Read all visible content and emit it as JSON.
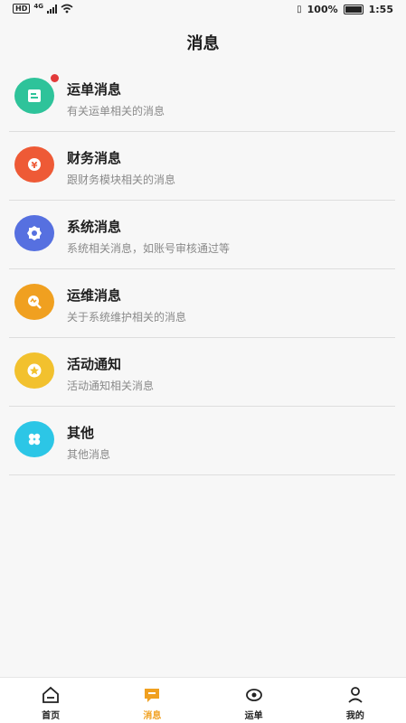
{
  "status_bar": {
    "network": "HD",
    "signal_label": "4G",
    "battery": "100%",
    "time": "1:55"
  },
  "page": {
    "title": "消息"
  },
  "messages": [
    {
      "name": "运单消息",
      "desc": "有关运单相关的消息",
      "icon": "document-icon",
      "color": "#2ec39a",
      "unread": true
    },
    {
      "name": "财务消息",
      "desc": "跟财务模块相关的消息",
      "icon": "yen-icon",
      "color": "#ee5a36",
      "unread": false
    },
    {
      "name": "系统消息",
      "desc": "系统相关消息，如账号审核通过等",
      "icon": "gear-icon",
      "color": "#5670e0",
      "unread": false
    },
    {
      "name": "运维消息",
      "desc": "关于系统维护相关的消息",
      "icon": "maintenance-icon",
      "color": "#f0a020",
      "unread": false
    },
    {
      "name": "活动通知",
      "desc": "活动通知相关消息",
      "icon": "star-icon",
      "color": "#f2c12e",
      "unread": false
    },
    {
      "name": "其他",
      "desc": "其他消息",
      "icon": "grid-icon",
      "color": "#2cc6e6",
      "unread": false
    }
  ],
  "tabbar": {
    "tabs": [
      {
        "label": "首页",
        "icon": "home-icon"
      },
      {
        "label": "消息",
        "icon": "chat-icon",
        "active": true
      },
      {
        "label": "运单",
        "icon": "eye-icon"
      },
      {
        "label": "我的",
        "icon": "user-icon"
      }
    ],
    "active_color": "#f0a020"
  }
}
